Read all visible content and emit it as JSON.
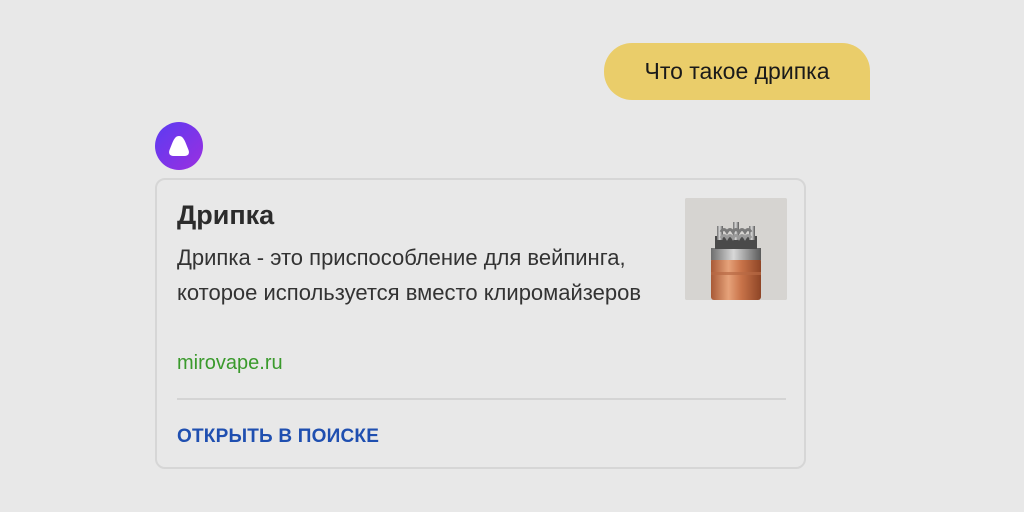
{
  "user_message": {
    "text": "Что такое дрипка"
  },
  "assistant": {
    "avatar_icon": "alice-logo-icon",
    "accent_colors": [
      "#5b3bf2",
      "#9b2fe0"
    ]
  },
  "card": {
    "title": "Дрипка",
    "text": "Дрипка - это приспособление для вейпинга, которое используется вместо клиромайзеров",
    "source": "mirovape.ru",
    "thumbnail_icon": "dripper-atomizer-image",
    "action_label": "ОТКРЫТЬ В ПОИСКЕ"
  },
  "colors": {
    "background": "#e8e8e8",
    "user_bubble": "#eacd6a",
    "source_link": "#3a9a2c",
    "action_link": "#1f4fb0"
  }
}
